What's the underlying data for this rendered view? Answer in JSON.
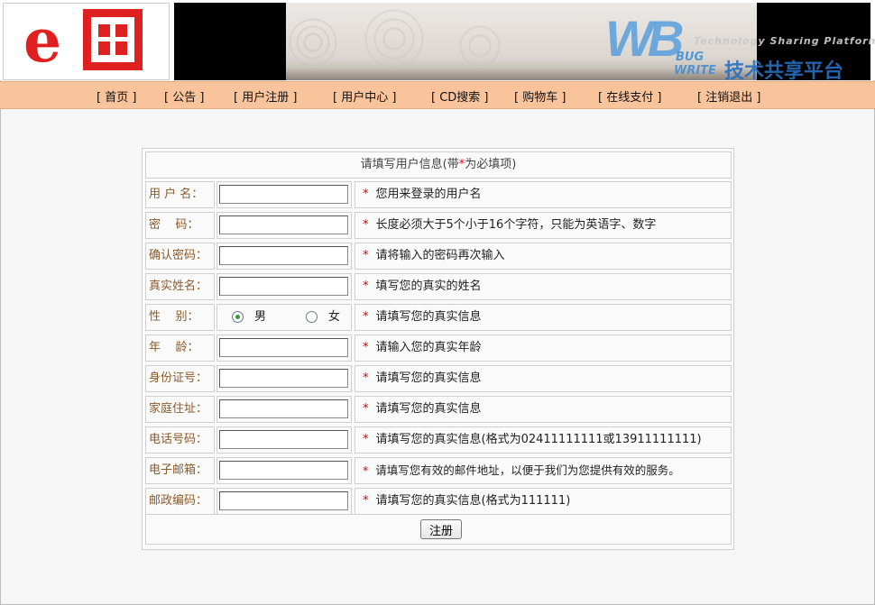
{
  "header": {
    "logo_e": "e",
    "watermark": {
      "letters": "WB",
      "bug": "BUG",
      "write": "WRITE",
      "tagline": "Technology Sharing Platform",
      "cn": "技术共享平台"
    }
  },
  "nav": {
    "items": [
      {
        "label": "[ 首页 ]"
      },
      {
        "label": "[ 公告 ]"
      },
      {
        "label": "[ 用户注册 ]"
      },
      {
        "label": "[ 用户中心 ]"
      },
      {
        "label": "[ CD搜索 ]"
      },
      {
        "label": "[ 购物车 ]"
      },
      {
        "label": "[ 在线支付 ]"
      },
      {
        "label": "[ 注销退出 ]"
      }
    ]
  },
  "form": {
    "caption_pre": "请填写用户信息(带",
    "caption_star": "*",
    "caption_post": "为必填项)",
    "star": "*",
    "rows": [
      {
        "label": "用 户 名：",
        "hint": "您用来登录的用户名",
        "value": ""
      },
      {
        "label": "密    码：",
        "hint": "长度必须大于5个小于16个字符，只能为英语字、数字",
        "value": ""
      },
      {
        "label": "确认密码：",
        "hint": "请将输入的密码再次输入",
        "value": ""
      },
      {
        "label": "真实姓名：",
        "hint": "填写您的真实的姓名",
        "value": ""
      },
      {
        "label": "性    别：",
        "hint": "请填写您的真实信息"
      },
      {
        "label": "年    龄：",
        "hint": "请输入您的真实年龄",
        "value": ""
      },
      {
        "label": "身份证号：",
        "hint": "请填写您的真实信息",
        "value": ""
      },
      {
        "label": "家庭住址：",
        "hint": "请填写您的真实信息",
        "value": ""
      },
      {
        "label": "电话号码：",
        "hint": "请填写您的真实信息(格式为02411111111或13911111111)",
        "value": ""
      },
      {
        "label": "电子邮箱：",
        "hint": "请填写您有效的邮件地址，以便于我们为您提供有效的服务。",
        "value": ""
      },
      {
        "label": "邮政编码：",
        "hint": "请填写您的真实信息(格式为111111)",
        "value": ""
      }
    ],
    "gender": {
      "male": "男",
      "female": "女",
      "selected": "男"
    },
    "submit_label": "注册"
  },
  "colors": {
    "nav_bg": "#f9c39b",
    "label_text": "#8b5a2b",
    "required_star": "#dd0000",
    "logo_red": "#e02020"
  }
}
